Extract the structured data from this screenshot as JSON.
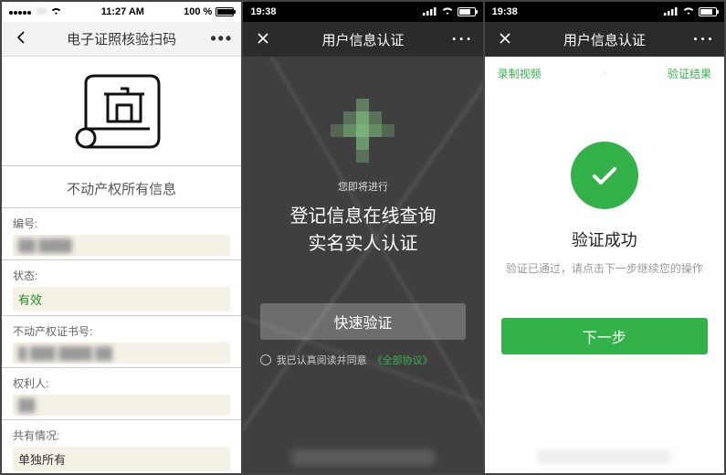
{
  "screen1": {
    "status": {
      "carrier_blur": "•••",
      "time": "11:27 AM",
      "battery_text": "100 %"
    },
    "nav": {
      "title": "电子证照核验扫码"
    },
    "section_title": "不动产权所有信息",
    "fields": [
      {
        "label": "编号:",
        "value_blur": "██ ████",
        "style": ""
      },
      {
        "label": "状态:",
        "value": "有效",
        "style": "green"
      },
      {
        "label": "不动产权证书号:",
        "value_blur": "█  ███ ████ ██",
        "style": ""
      },
      {
        "label": "权利人:",
        "value_blur": "██",
        "style": ""
      },
      {
        "label": "共有情况:",
        "value": "单独所有",
        "style": ""
      }
    ]
  },
  "screen2": {
    "status": {
      "time": "19:38"
    },
    "nav": {
      "title": "用户信息认证"
    },
    "pre": "您即将进行",
    "title_line1": "登记信息在线查询",
    "title_line2": "实名实人认证",
    "button": "快速验证",
    "agree_text": "我已认真阅读并同意",
    "agree_link": "《全部协议》"
  },
  "screen3": {
    "status": {
      "time": "19:38"
    },
    "nav": {
      "title": "用户信息认证"
    },
    "tabs": {
      "left": "录制视频",
      "dot": "·",
      "right": "验证结果"
    },
    "result_title": "验证成功",
    "result_sub": "验证已通过，请点击下一步继续您的操作",
    "button": "下一步"
  }
}
